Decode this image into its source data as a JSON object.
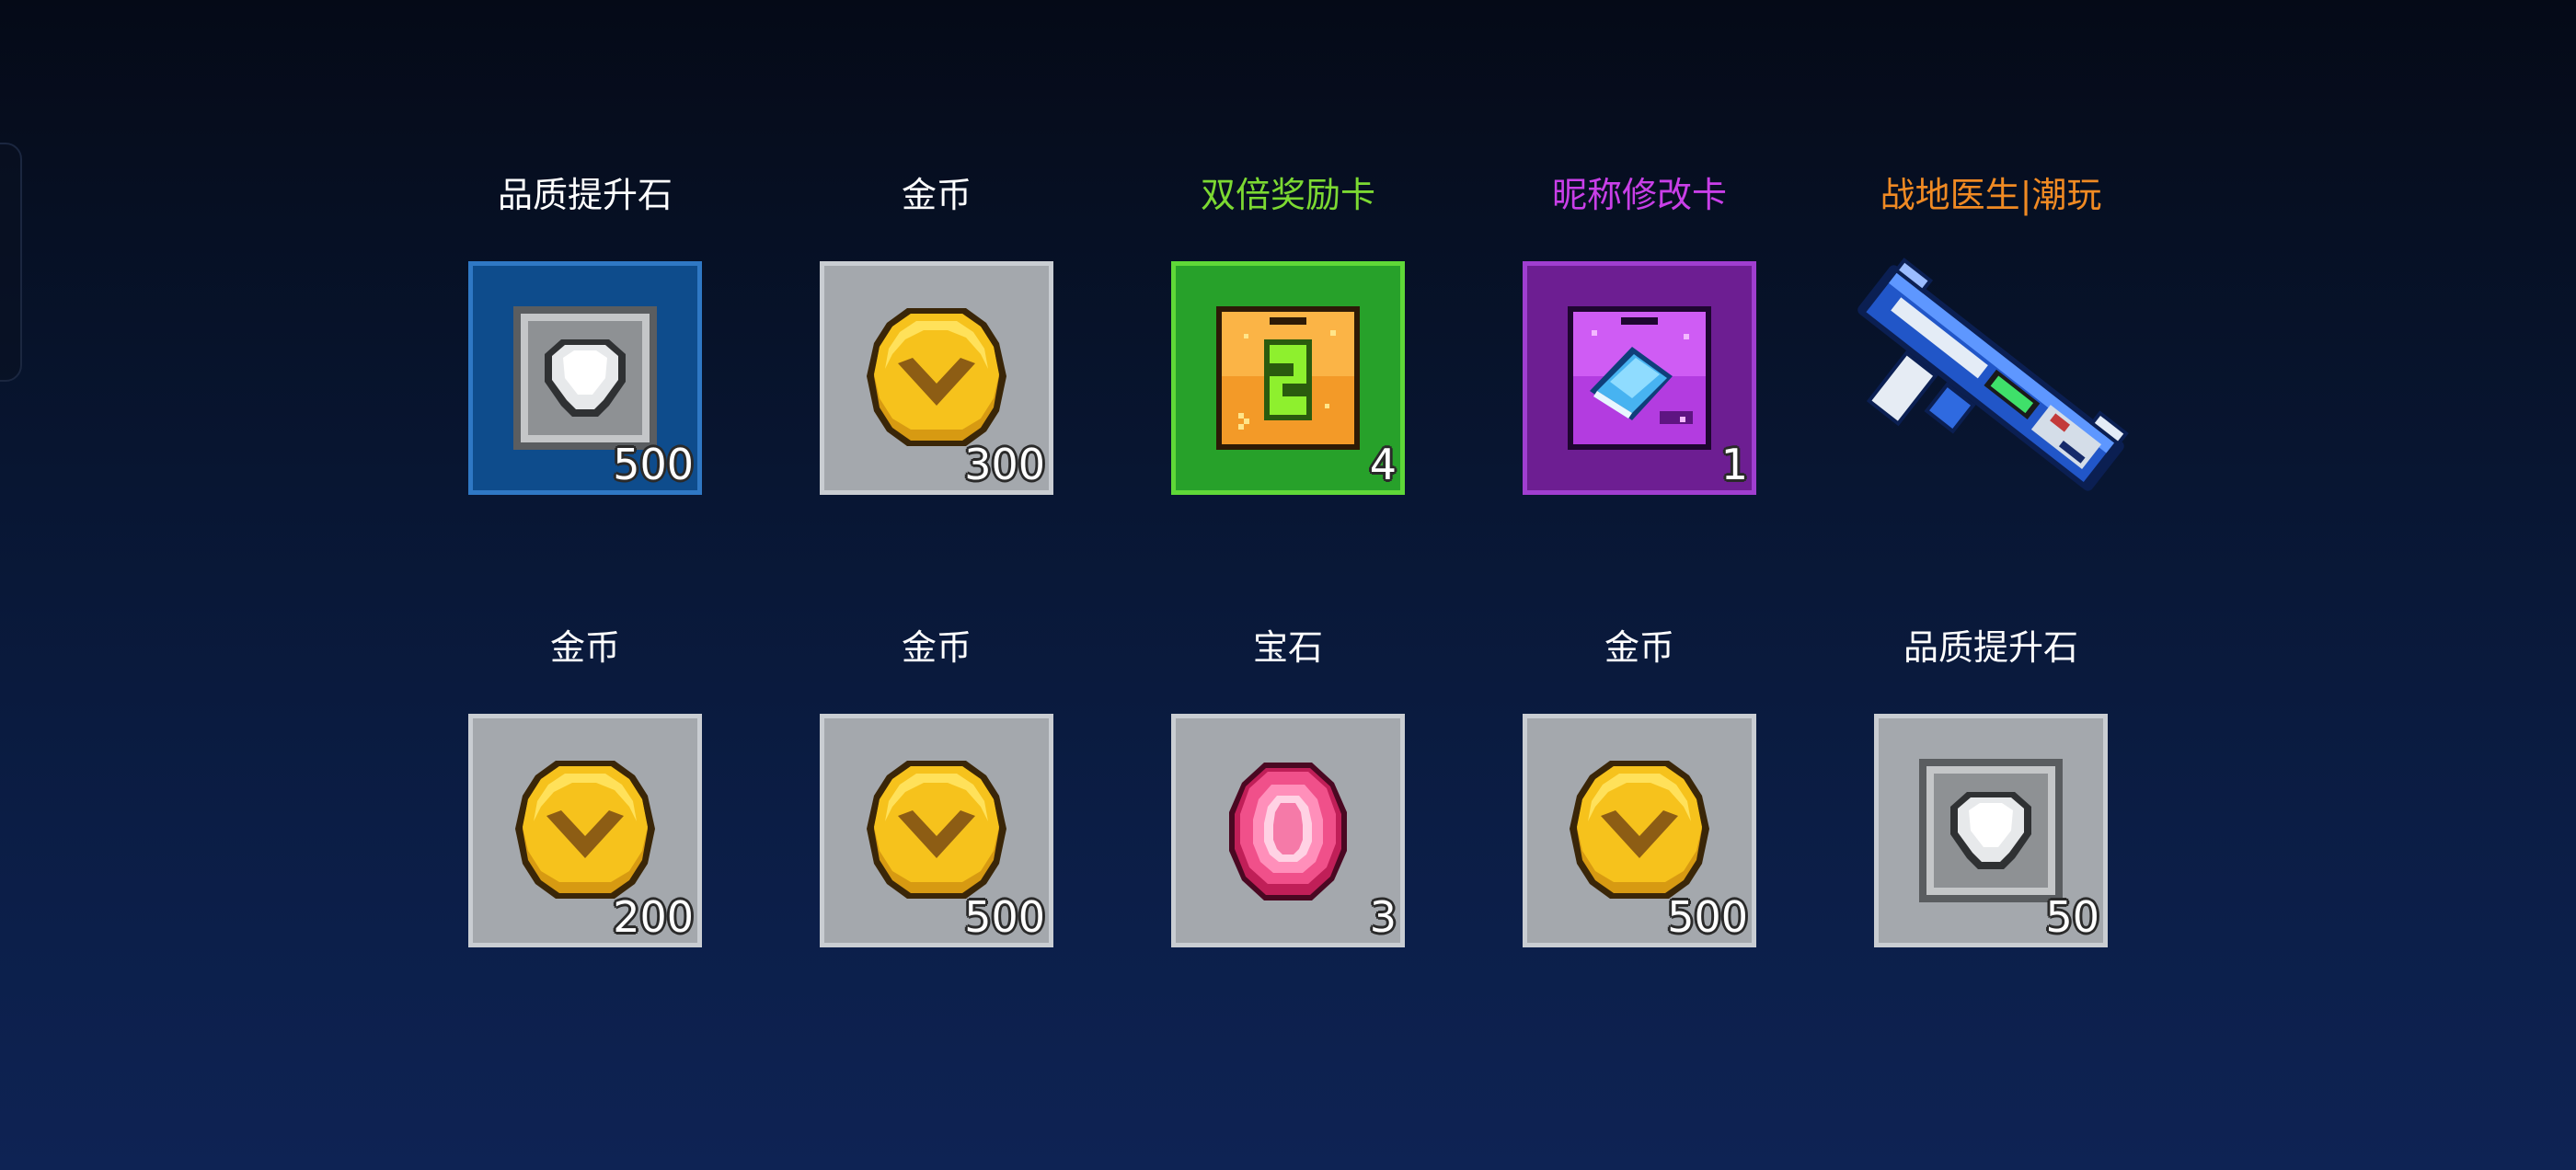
{
  "rewards": {
    "row1": [
      {
        "name": "品质提升石",
        "count": "500",
        "name_color": "#ffffff",
        "tile_bg": "#0e4c8c",
        "tile_border": "#2f78c4",
        "icon": "quality-stone-icon"
      },
      {
        "name": "金币",
        "count": "300",
        "name_color": "#ffffff",
        "tile_bg": "#a4a8ad",
        "tile_border": "#c9cdd2",
        "icon": "gold-coin-icon"
      },
      {
        "name": "双倍奖励卡",
        "count": "4",
        "name_color": "#7cd932",
        "tile_bg": "#27a12a",
        "tile_border": "#5fd838",
        "icon": "double-reward-card-icon"
      },
      {
        "name": "昵称修改卡",
        "count": "1",
        "name_color": "#c93fe8",
        "tile_bg": "#6d1e92",
        "tile_border": "#a03ed0",
        "icon": "rename-card-icon"
      },
      {
        "name": "战地医生|潮玩",
        "count": "",
        "name_color": "#f08a23",
        "tile_bg": "",
        "tile_border": "",
        "icon": "weapon-blaster-icon"
      }
    ],
    "row2": [
      {
        "name": "金币",
        "count": "200",
        "name_color": "#ffffff",
        "tile_bg": "#a4a8ad",
        "tile_border": "#c9cdd2",
        "icon": "gold-coin-icon"
      },
      {
        "name": "金币",
        "count": "500",
        "name_color": "#ffffff",
        "tile_bg": "#a4a8ad",
        "tile_border": "#c9cdd2",
        "icon": "gold-coin-icon"
      },
      {
        "name": "宝石",
        "count": "3",
        "name_color": "#ffffff",
        "tile_bg": "#a4a8ad",
        "tile_border": "#c9cdd2",
        "icon": "gem-icon"
      },
      {
        "name": "金币",
        "count": "500",
        "name_color": "#ffffff",
        "tile_bg": "#a4a8ad",
        "tile_border": "#c9cdd2",
        "icon": "gold-coin-icon"
      },
      {
        "name": "品质提升石",
        "count": "50",
        "name_color": "#ffffff",
        "tile_bg": "#a4a8ad",
        "tile_border": "#c9cdd2",
        "icon": "quality-stone-icon"
      }
    ]
  }
}
